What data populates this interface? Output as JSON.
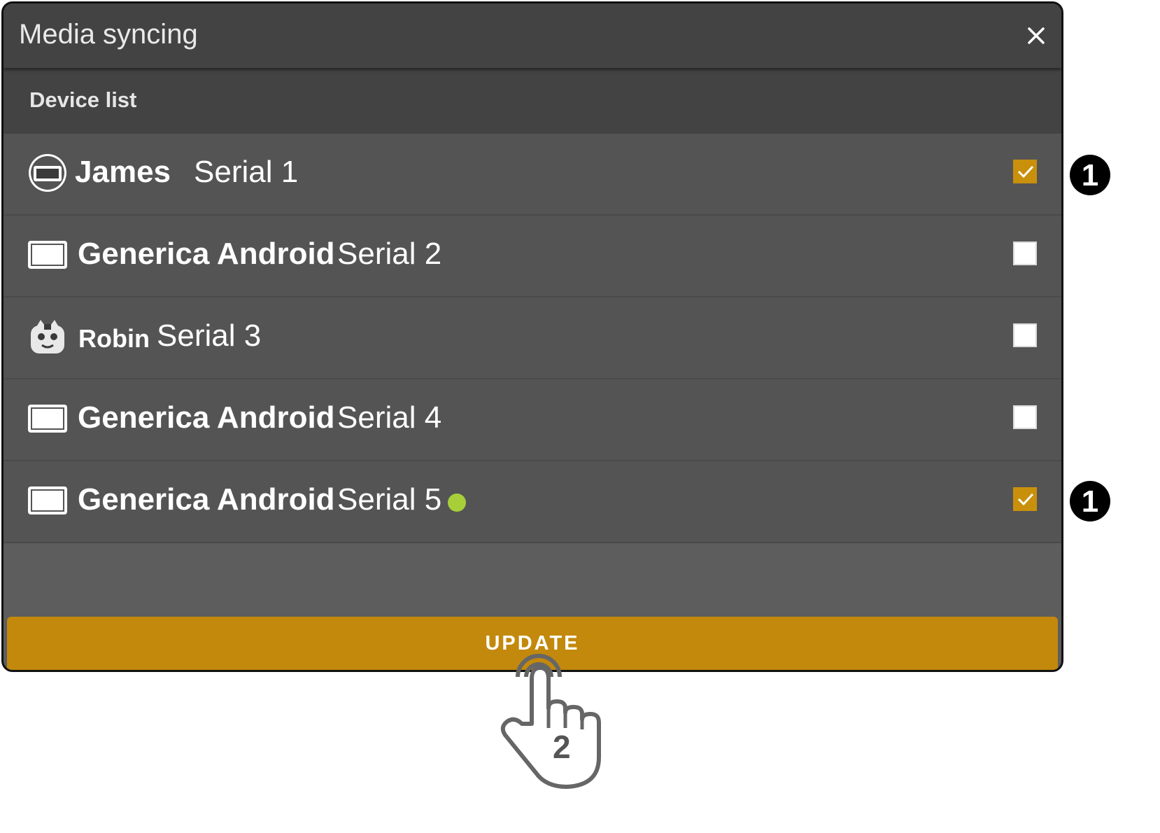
{
  "dialog": {
    "title": "Media syncing",
    "close_icon": "close-icon"
  },
  "device_list": {
    "label": "Device list",
    "devices": [
      {
        "name": "James",
        "serial": "Serial 1",
        "icon": "round-tablet-icon",
        "checked": true
      },
      {
        "name": "Generica Android",
        "serial": "Serial 2",
        "icon": "tablet-icon",
        "checked": false
      },
      {
        "name": "Robin",
        "serial": "Serial 3",
        "icon": "robot-icon",
        "checked": false
      },
      {
        "name": "Generica Android",
        "serial": "Serial 4",
        "icon": "tablet-icon",
        "checked": false
      },
      {
        "name": "Generica Android",
        "serial": "Serial 5",
        "icon": "tablet-icon",
        "checked": true,
        "online": true
      }
    ]
  },
  "footer": {
    "update_label": "UPDATE"
  },
  "annotations": {
    "step1": "1",
    "step2": "2"
  },
  "colors": {
    "accent": "#c2890c",
    "checkbox_checked": "#c9900c",
    "online_status": "#a7cf3a"
  }
}
